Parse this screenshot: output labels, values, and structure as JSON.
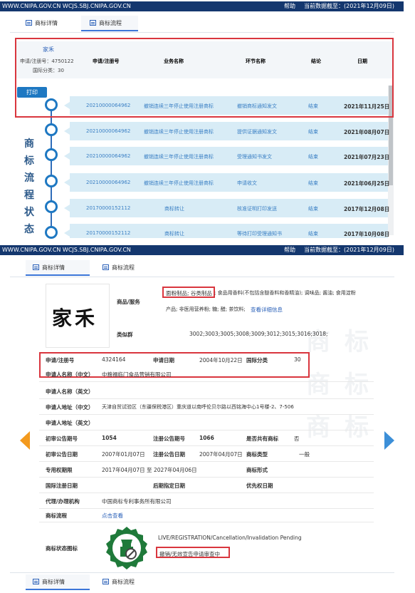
{
  "top_bar": {
    "url": "WWW.CNIPA.GOV.CN WCJS.SBJ.CNIPA.GOV.CN",
    "help": "帮助",
    "date": "当前数据截至：(2021年12月09日)"
  },
  "tabs": [
    "商标详情",
    "商标流程"
  ],
  "panel1": {
    "mark_name": "家禾",
    "reg_no_label": "申请/注册号：4750122",
    "intl_class_label": "国际分类：30",
    "print_button": "打印",
    "headers": [
      "申请/注册号",
      "业务名称",
      "环节名称",
      "结论",
      "日期"
    ],
    "side_label": [
      "商",
      "标",
      "流",
      "程",
      "状",
      "态"
    ],
    "rows": [
      {
        "no": "20210000064962",
        "biz": "撤销连续三年停止使用注册商标",
        "step": "撤销商标通知发文",
        "result": "结束",
        "date": "2021年11月25日"
      },
      {
        "no": "20210000064962",
        "biz": "撤销连续三年停止使用注册商标",
        "step": "提供证据通知发文",
        "result": "结束",
        "date": "2021年08月07日"
      },
      {
        "no": "20210000064962",
        "biz": "撤销连续三年停止使用注册商标",
        "step": "受理通知书发文",
        "result": "结束",
        "date": "2021年07月23日"
      },
      {
        "no": "20210000064962",
        "biz": "撤销连续三年停止使用注册商标",
        "step": "申请收文",
        "result": "结束",
        "date": "2021年06月25日"
      },
      {
        "no": "20170000152112",
        "biz": "商标转让",
        "step": "核准证明打印发送",
        "result": "结束",
        "date": "2017年12月08日"
      },
      {
        "no": "20170000152112",
        "biz": "商标转让",
        "step": "等待打印受理通知书",
        "result": "结束",
        "date": "2017年10月08日"
      }
    ]
  },
  "panel2": {
    "mark_image_text": "家禾",
    "goods_label": "商品/服务",
    "goods_highlight": "面粉制品; 谷类制品",
    "goods_rest_1": "; 食品用香料(不包括含醚香料和香精油); 调味品; 酱油; 食用淀粉",
    "goods_rest_2": "产品; 非医用营养粉; 糖; 醋; 茶饮料;",
    "goods_link": "查看详细信息",
    "similar_label": "类似群",
    "similar_value": "3002;3003;3005;3008;3009;3012;3015;3016;3018;",
    "reg_no_label": "申请/注册号",
    "reg_no": "4324164",
    "apply_date_label": "申请日期",
    "apply_date": "2004年10月22日",
    "intl_class_label": "国际分类",
    "intl_class": "30",
    "applicant_cn_label": "申请人名称（中文）",
    "applicant_cn": "中粮福临门食品营销有限公司",
    "applicant_en_label": "申请人名称（英文）",
    "address_cn_label": "申请人地址（中文）",
    "address_cn": "天津自贸试验区（东疆保税港区）重庆道以南呼伦贝尔路以西铭海中心1号楼-2、7-506",
    "address_en_label": "申请人地址（英文）",
    "prelim_no_label": "初审公告期号",
    "prelim_no": "1054",
    "reg_pub_no_label": "注册公告期号",
    "reg_pub_no": "1066",
    "shared_label": "是否共有商标",
    "shared": "否",
    "prelim_date_label": "初审公告日期",
    "prelim_date": "2007年01月07日",
    "reg_pub_date_label": "注册公告日期",
    "reg_pub_date": "2007年04月07日",
    "type_label": "商标类型",
    "type": "一般",
    "exclusive_label": "专用权期限",
    "exclusive": "2017年04月07日 至 2027年04月06日",
    "form_label": "商标形式",
    "intl_reg_date_label": "国际注册日期",
    "later_date_label": "后期指定日期",
    "priority_label": "优先权日期",
    "agent_label": "代理/办理机构",
    "agent": "中国商标专利事务所有限公司",
    "flow_label": "商标流程",
    "flow_link": "点击查看",
    "status_label": "商标状态图标",
    "status_en": "LIVE/REGISTRATION/Cancellation/Invalidation Pending",
    "status_cn": "撤销/无效宣告申请审查中",
    "watermark": "商标"
  },
  "colors": {
    "topbar": "#14376e",
    "row_bg": "#d8ecf6",
    "accent": "#1e78c2",
    "nav_orange": "#f39a1e",
    "nav_blue": "#3c8fd8",
    "red_box": "#d9363e"
  }
}
